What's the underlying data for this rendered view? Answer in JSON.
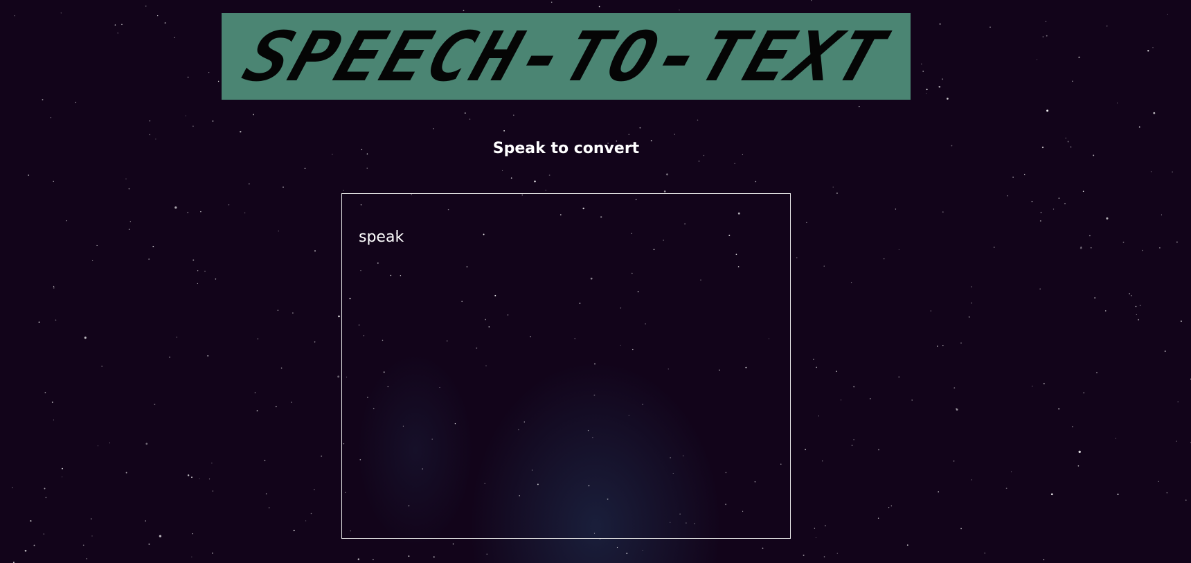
{
  "banner": {
    "title": "SPEECH-TO-TEXT"
  },
  "main": {
    "subtitle": "Speak to convert",
    "transcript_text": "speak"
  },
  "colors": {
    "background": "#12041a",
    "banner": "#4b8573",
    "banner_text": "#050505",
    "text": "#ffffff"
  }
}
